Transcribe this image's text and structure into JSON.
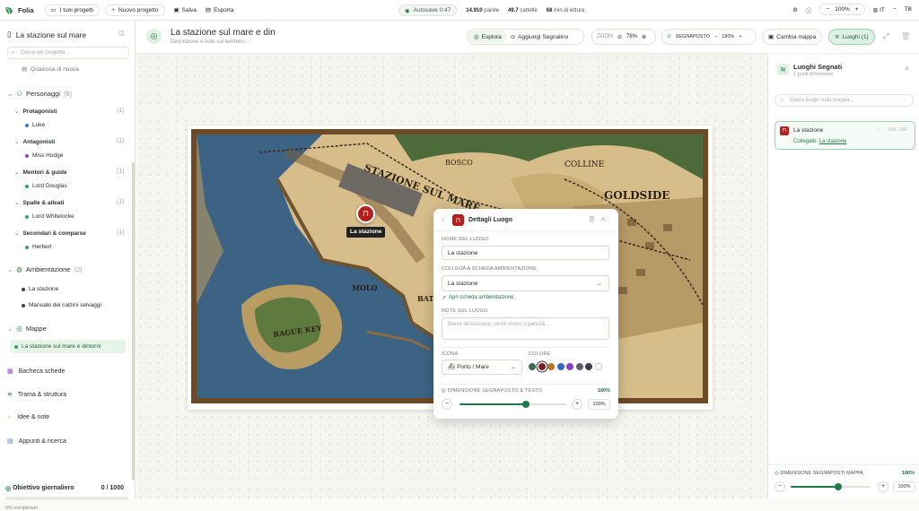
{
  "app": {
    "name": "Folia"
  },
  "topbar": {
    "projects": "I tuoi progetti",
    "new_project": "Nuovo progetto",
    "save": "Salva",
    "export": "Esporta",
    "autosave": "Autosave 0:47",
    "words_value": "14.910",
    "words_label": "parole",
    "pages_value": "49.7",
    "pages_label": "cartelle",
    "minutes_value": "68",
    "minutes_label": "min di lettura",
    "zoom": "100%",
    "lang": "IT",
    "user": "TB"
  },
  "sidebar": {
    "project_title": "La stazione sul mare",
    "search_placeholder": "Cerca nel progetto...",
    "prev_item": "Qualcosa di nuova",
    "characters": {
      "label": "Personaggi",
      "count": "(8)",
      "groups": [
        {
          "label": "Protagonisti",
          "count": "(1)",
          "items": [
            {
              "name": "Luke",
              "color": "#2f7fd1"
            }
          ]
        },
        {
          "label": "Antagonisti",
          "count": "(1)",
          "items": [
            {
              "name": "Miss Hodge",
              "color": "#9b3fc6"
            }
          ]
        },
        {
          "label": "Mentori & guide",
          "count": "(1)",
          "items": [
            {
              "name": "Lord Douglas",
              "color": "#2fa36a"
            }
          ]
        },
        {
          "label": "Spalle & alleati",
          "count": "(1)",
          "items": [
            {
              "name": "Lord Whitelocke",
              "color": "#2fa36a"
            }
          ]
        },
        {
          "label": "Secondari & comparse",
          "count": "(1)",
          "items": [
            {
              "name": "Herbert",
              "color": "#2fa36a"
            }
          ]
        }
      ]
    },
    "settings": {
      "label": "Ambientazione",
      "count": "(2)",
      "items": [
        "La stazione",
        "Manuale dei calzini selvaggi"
      ]
    },
    "maps": {
      "label": "Mappe",
      "items": [
        "La stazione sul mare e dintorni"
      ]
    },
    "nav": [
      "Bacheca schede",
      "Trama & struttura",
      "Idee & note",
      "Appunti & ricerca"
    ],
    "goal": {
      "label": "Obiettivo giornaliero",
      "value": "0 / 1000",
      "progress": 0,
      "pct_label": "0% completato"
    }
  },
  "header": {
    "title": "La stazione sul mare e din",
    "subtitle": "Descrizione o note sul territorio...",
    "mode_explore": "Esplora",
    "mode_add": "Aggiungi Segnalino",
    "zoom_label": "ZOOM",
    "zoom_value": "78%",
    "marker_label": "SEGNAPOSTO",
    "marker_value": "180%",
    "change_map": "Cambia mappa",
    "places": "Luoghi (1)"
  },
  "map": {
    "labels": [
      "STAZIONE SUL MARE",
      "BOSCO",
      "COLLINE",
      "GOLDSIDE",
      "MOLO",
      "BATI",
      "RAGUE KEY"
    ],
    "marker_label": "La stazione"
  },
  "details": {
    "title": "Dettagli Luogo",
    "name_label": "NOME DEL LUOGO",
    "name_value": "La stazione",
    "link_label": "COLLEGA A SCHEDA AMBIENTAZIONE",
    "link_value": "La stazione",
    "open_link": "Apri scheda ambientazione",
    "notes_label": "NOTE SUL LUOGO",
    "notes_placeholder": "Breve descrizione, cenni storici o pericoli...",
    "icon_label": "ICONA",
    "icon_value": "Porto / Mare",
    "color_label": "COLORE",
    "colors": [
      "#3d6b4f",
      "#7a2020",
      "#b8742a",
      "#3466c4",
      "#8a3fc6",
      "#5a5f6b",
      "#3b3f46",
      "#ffffff"
    ],
    "size_label": "DIMENSIONE SEGNAPOSTO & TESTO",
    "size_value": "180%",
    "size_level": 0.62,
    "pct_value": "100%"
  },
  "right_panel": {
    "title": "Luoghi Segnati",
    "subtitle": "1 punti d'interesse",
    "search_placeholder": "Cerca luogo sulla mappa...",
    "place_name": "La stazione",
    "place_meta": "Sdk. 180",
    "linked_label": "Collegato:",
    "linked_value": "La stazione",
    "size_label": "DIMENSIONE SEGNAPOSTI MAPPA",
    "size_value": "180%",
    "size_level": 0.6,
    "pct_value": "100%"
  }
}
